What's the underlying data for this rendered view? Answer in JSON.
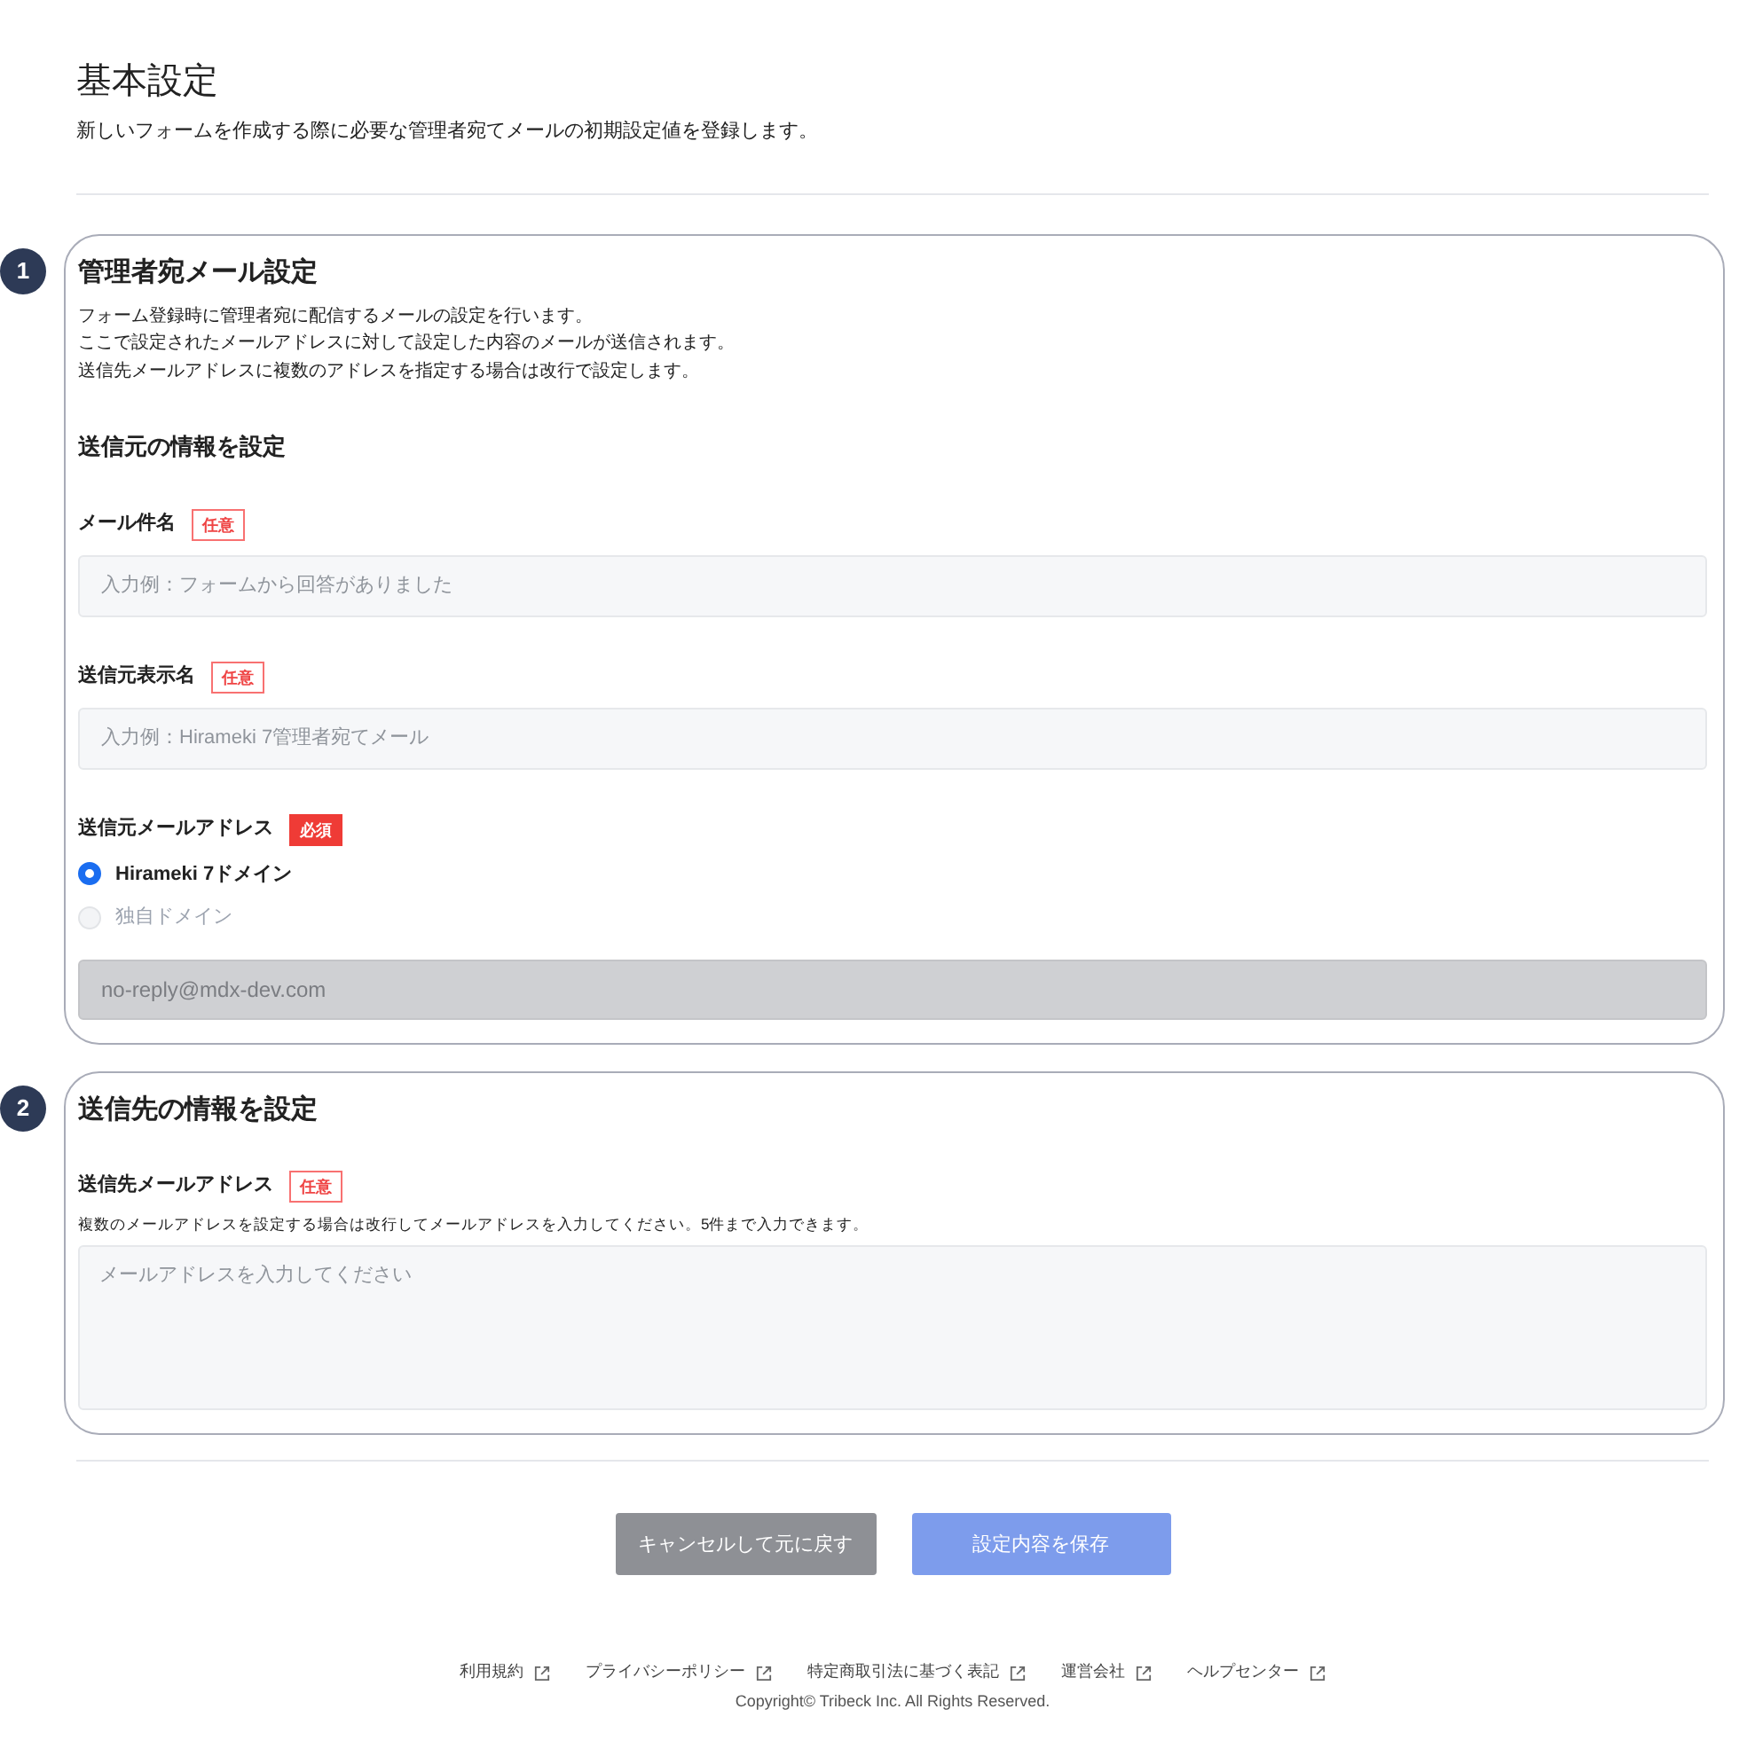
{
  "page": {
    "title": "基本設定",
    "description": "新しいフォームを作成する際に必要な管理者宛てメールの初期設定値を登録します。"
  },
  "sections": [
    {
      "number": "1",
      "title": "管理者宛メール設定",
      "description": [
        "フォーム登録時に管理者宛に配信するメールの設定を行います。",
        "ここで設定されたメールアドレスに対して設定した内容のメールが送信されます。",
        "送信先メールアドレスに複数のアドレスを指定する場合は改行で設定します。"
      ],
      "subheading": "送信元の情報を設定",
      "fields": [
        {
          "kind": "text",
          "label": "メール件名",
          "tag": {
            "label": "任意",
            "kind": "optional"
          },
          "placeholder": "入力例：フォームから回答がありました"
        },
        {
          "kind": "text",
          "label": "送信元表示名",
          "tag": {
            "label": "任意",
            "kind": "optional"
          },
          "placeholder": "入力例：Hirameki 7管理者宛てメール"
        },
        {
          "kind": "radio",
          "label": "送信元メールアドレス",
          "tag": {
            "label": "必須",
            "kind": "required"
          },
          "options": [
            {
              "label": "Hirameki 7ドメイン",
              "selected": true,
              "disabled": false
            },
            {
              "label": "独自ドメイン",
              "selected": false,
              "disabled": true
            }
          ]
        },
        {
          "kind": "readonly",
          "value": "no-reply@mdx-dev.com"
        }
      ]
    },
    {
      "number": "2",
      "title": "送信先の情報を設定",
      "fields": [
        {
          "kind": "textarea",
          "label": "送信先メールアドレス",
          "tag": {
            "label": "任意",
            "kind": "optional"
          },
          "help": "複数のメールアドレスを設定する場合は改行してメールアドレスを入力してください。5件まで入力できます。",
          "placeholder": "メールアドレスを入力してください"
        }
      ]
    }
  ],
  "buttons": [
    {
      "label": "キャンセルして元に戻す",
      "kind": "cancel",
      "disabled": true
    },
    {
      "label": "設定内容を保存",
      "kind": "save",
      "disabled": true
    }
  ],
  "footer": {
    "links": [
      {
        "label": "利用規約"
      },
      {
        "label": "プライバシーポリシー"
      },
      {
        "label": "特定商取引法に基づく表記"
      },
      {
        "label": "運営会社"
      },
      {
        "label": "ヘルプセンター"
      }
    ],
    "copyright": "Copyright© Tribeck Inc. All Rights Reserved."
  }
}
